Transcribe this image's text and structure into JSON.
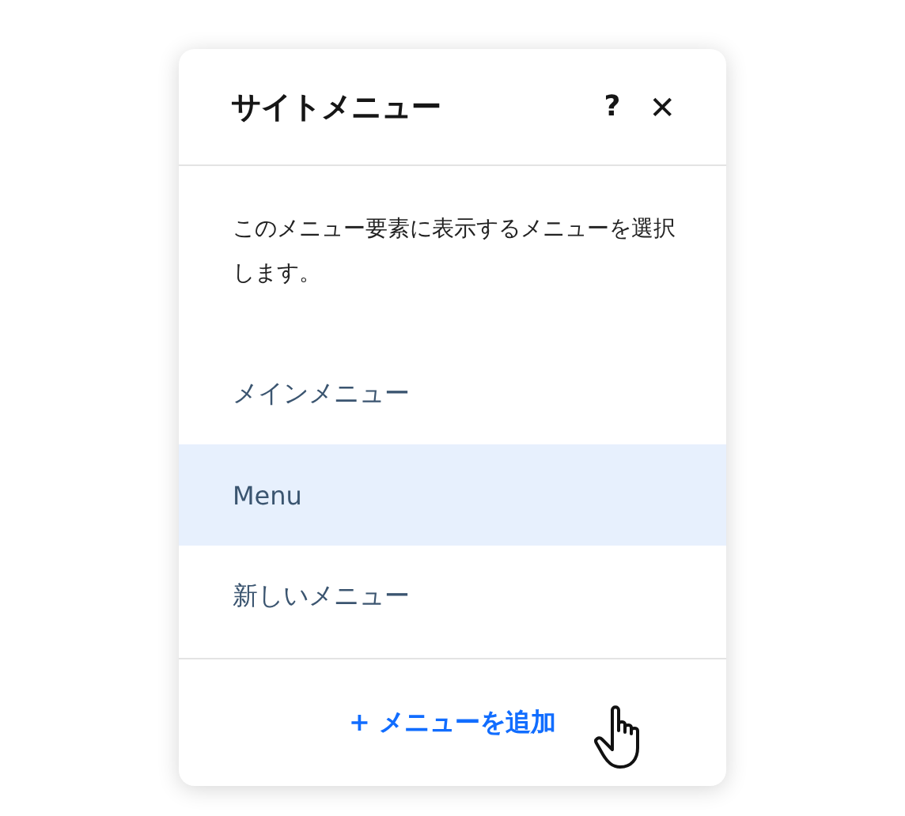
{
  "panel": {
    "title": "サイトメニュー",
    "help": "?",
    "close": "✕"
  },
  "description": "このメニュー要素に表示するメニューを選択します。",
  "menus": [
    {
      "label": "メインメニュー",
      "selected": false
    },
    {
      "label": "Menu",
      "selected": true
    },
    {
      "label": "新しいメニュー",
      "selected": false
    }
  ],
  "footer": {
    "add_button": "+ メニューを追加"
  }
}
